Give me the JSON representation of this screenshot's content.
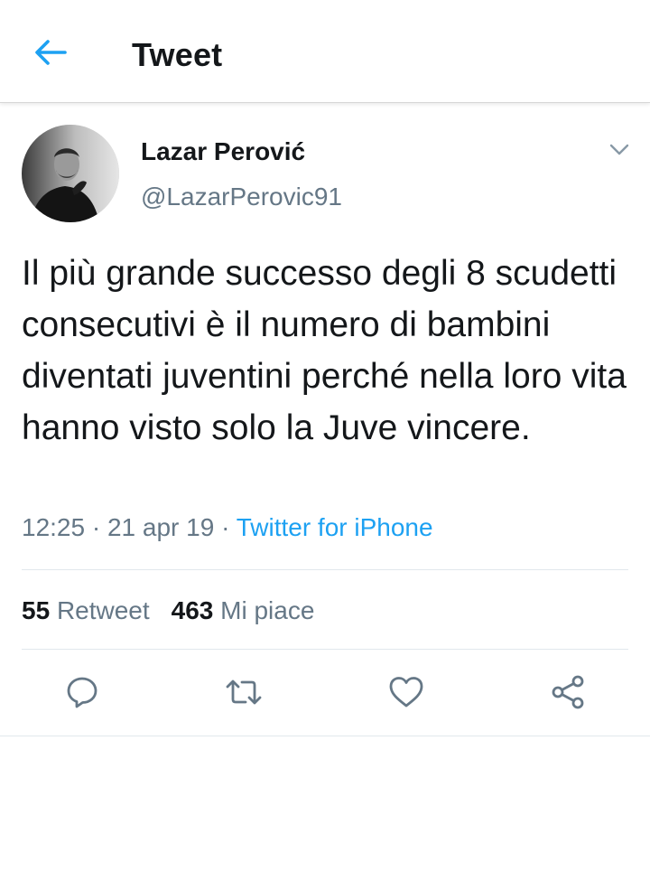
{
  "header": {
    "title": "Tweet",
    "back_icon": "arrow-left-icon",
    "accent_color": "#1da1f2"
  },
  "tweet": {
    "author": {
      "name": "Lazar Perović",
      "handle": "@LazarPerovic91",
      "avatar": "profile-photo"
    },
    "text": "Il più grande successo degli 8 scudetti consecutivi è il numero di bambini diventati juventini perché nella loro vita hanno visto solo la Juve vincere.",
    "time": "12:25",
    "separator1": " · ",
    "date": "21 apr 19",
    "separator2": " · ",
    "source": "Twitter for iPhone",
    "retweets": {
      "count": "55",
      "label": "Retweet"
    },
    "likes": {
      "count": "463",
      "label": "Mi piace"
    }
  },
  "actions": {
    "reply_icon": "reply-icon",
    "retweet_icon": "retweet-icon",
    "like_icon": "heart-icon",
    "share_icon": "share-icon"
  },
  "colors": {
    "text_primary": "#14171a",
    "text_secondary": "#657786",
    "link": "#1da1f2",
    "divider": "#e1e8ed"
  }
}
